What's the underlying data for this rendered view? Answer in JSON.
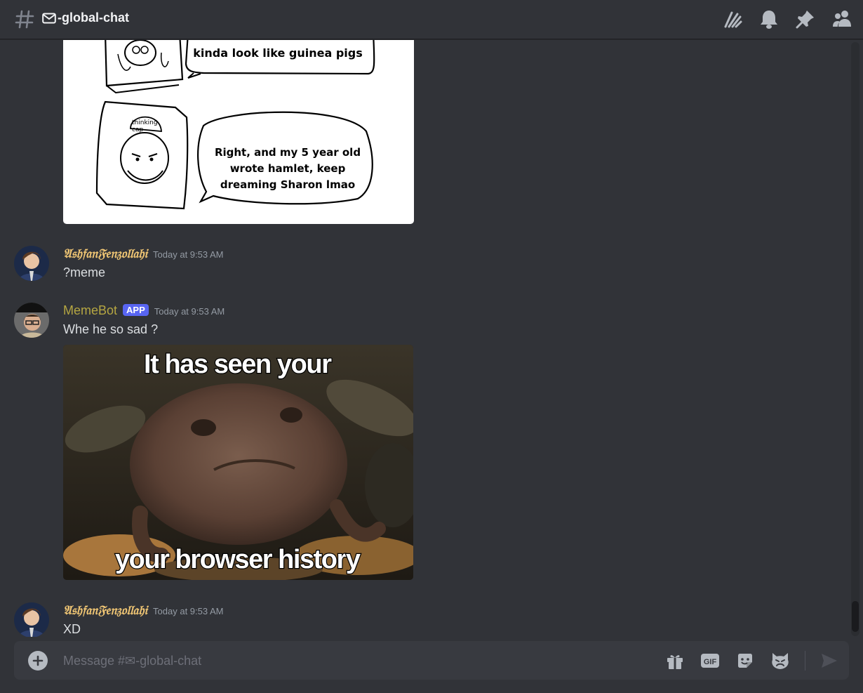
{
  "header": {
    "channel_name": "-global-chat",
    "icons": [
      "threads-icon",
      "bell-icon",
      "pin-icon",
      "members-icon"
    ]
  },
  "comic": {
    "panel1_text": "kinda look like guinea pigs",
    "panel2_cap": "thinking cap",
    "panel2_text_line1": "Right, and my 5 year old",
    "panel2_text_line2": "wrote hamlet, keep",
    "panel2_text_line3": "dreaming Sharon lmao"
  },
  "messages": [
    {
      "author": "𝔄𝔰𝔥𝔣𝔞𝔫𝔉𝔢𝔫𝔷𝔬𝔩𝔩𝔞𝔥𝔦",
      "author_color": "#f0c674",
      "timestamp": "Today at 9:53 AM",
      "text": "?meme"
    },
    {
      "author": "MemeBot",
      "author_color": "#b5a642",
      "badge": "APP",
      "timestamp": "Today at 9:53 AM",
      "text": "Whe he so sad ?",
      "meme_top": "It has seen your",
      "meme_bottom": "your browser history"
    },
    {
      "author": "𝔄𝔰𝔥𝔣𝔞𝔫𝔉𝔢𝔫𝔷𝔬𝔩𝔩𝔞𝔥𝔦",
      "author_color": "#f0c674",
      "timestamp": "Today at 9:53 AM",
      "text": "XD"
    }
  ],
  "composer": {
    "placeholder": "Message #✉-global-chat",
    "icons": [
      "gift-icon",
      "gif-icon",
      "sticker-icon",
      "emoji-icon",
      "send-icon"
    ],
    "gif_label": "GIF"
  },
  "colors": {
    "background": "#313338",
    "accent": "#5865f2"
  }
}
